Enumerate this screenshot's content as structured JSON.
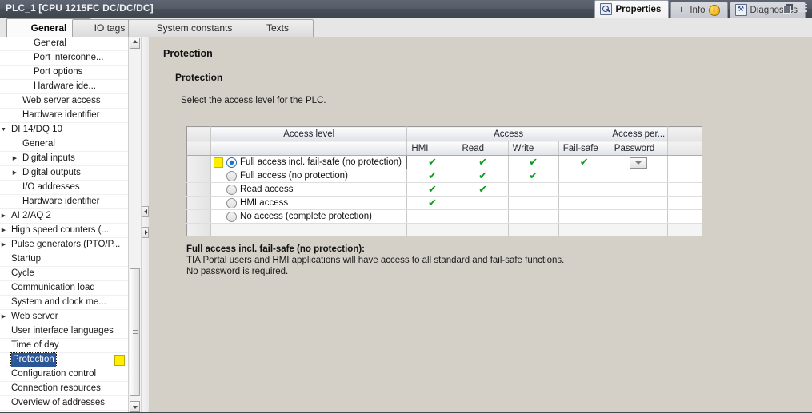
{
  "window": {
    "title": "PLC_1 [CPU 1215FC DC/DC/DC]",
    "tabs": [
      {
        "label": "Properties",
        "icon": "properties-icon",
        "active": true
      },
      {
        "label": "Info",
        "icon": "info-icon",
        "badge": "i",
        "active": false
      },
      {
        "label": "Diagnostics",
        "icon": "diagnostics-icon",
        "active": false
      }
    ],
    "controls": [
      "restore-icon",
      "menu-icon"
    ]
  },
  "main_tabs": [
    {
      "label": "General",
      "active": true
    },
    {
      "label": "IO tags",
      "active": false
    },
    {
      "label": "System constants",
      "active": false
    },
    {
      "label": "Texts",
      "active": false
    }
  ],
  "nav": {
    "items": [
      {
        "label": "General",
        "indent": 3,
        "arrow": "",
        "selected": false,
        "marker": false
      },
      {
        "label": "Port interconne...",
        "indent": 3,
        "arrow": "",
        "selected": false,
        "marker": false
      },
      {
        "label": "Port options",
        "indent": 3,
        "arrow": "",
        "selected": false,
        "marker": false
      },
      {
        "label": "Hardware ide...",
        "indent": 3,
        "arrow": "",
        "selected": false,
        "marker": false
      },
      {
        "label": "Web server access",
        "indent": 2,
        "arrow": "",
        "selected": false,
        "marker": false
      },
      {
        "label": "Hardware identifier",
        "indent": 2,
        "arrow": "",
        "selected": false,
        "marker": false
      },
      {
        "label": "DI 14/DQ 10",
        "indent": 1,
        "arrow": "expanded",
        "selected": false,
        "marker": false
      },
      {
        "label": "General",
        "indent": 2,
        "arrow": "",
        "selected": false,
        "marker": false
      },
      {
        "label": "Digital inputs",
        "indent": 2,
        "arrow": "collapsed",
        "selected": false,
        "marker": false
      },
      {
        "label": "Digital outputs",
        "indent": 2,
        "arrow": "collapsed",
        "selected": false,
        "marker": false
      },
      {
        "label": "I/O addresses",
        "indent": 2,
        "arrow": "",
        "selected": false,
        "marker": false
      },
      {
        "label": "Hardware identifier",
        "indent": 2,
        "arrow": "",
        "selected": false,
        "marker": false
      },
      {
        "label": "AI 2/AQ 2",
        "indent": 1,
        "arrow": "collapsed",
        "selected": false,
        "marker": false
      },
      {
        "label": "High speed counters (...",
        "indent": 1,
        "arrow": "collapsed",
        "selected": false,
        "marker": false
      },
      {
        "label": "Pulse generators (PTO/P...",
        "indent": 1,
        "arrow": "collapsed",
        "selected": false,
        "marker": false
      },
      {
        "label": "Startup",
        "indent": 1,
        "arrow": "",
        "selected": false,
        "marker": false
      },
      {
        "label": "Cycle",
        "indent": 1,
        "arrow": "",
        "selected": false,
        "marker": false
      },
      {
        "label": "Communication load",
        "indent": 1,
        "arrow": "",
        "selected": false,
        "marker": false
      },
      {
        "label": "System and clock me...",
        "indent": 1,
        "arrow": "",
        "selected": false,
        "marker": false
      },
      {
        "label": "Web server",
        "indent": 1,
        "arrow": "collapsed",
        "selected": false,
        "marker": false
      },
      {
        "label": "User interface languages",
        "indent": 1,
        "arrow": "",
        "selected": false,
        "marker": false
      },
      {
        "label": "Time of day",
        "indent": 1,
        "arrow": "",
        "selected": false,
        "marker": false
      },
      {
        "label": "Protection",
        "indent": 1,
        "arrow": "",
        "selected": true,
        "marker": true
      },
      {
        "label": "Configuration control",
        "indent": 1,
        "arrow": "",
        "selected": false,
        "marker": false
      },
      {
        "label": "Connection resources",
        "indent": 1,
        "arrow": "",
        "selected": false,
        "marker": false
      },
      {
        "label": "Overview of addresses",
        "indent": 1,
        "arrow": "",
        "selected": false,
        "marker": false
      }
    ]
  },
  "page": {
    "breadcrumb": "Protection",
    "group_title": "Protection",
    "instruction": "Select the access level for the PLC."
  },
  "table": {
    "header_top": {
      "access_level": "Access level",
      "access": "Access",
      "access_permission": "Access per..."
    },
    "header_sub": {
      "hmi": "HMI",
      "read": "Read",
      "write": "Write",
      "failsafe": "Fail-safe",
      "password": "Password"
    },
    "check_glyph": "✔",
    "rows": [
      {
        "label": "Full access incl. fail-safe (no protection)",
        "selected": true,
        "marker": true,
        "hmi": true,
        "read": true,
        "write": true,
        "failsafe": true,
        "password_button": true
      },
      {
        "label": "Full access (no protection)",
        "selected": false,
        "marker": false,
        "hmi": true,
        "read": true,
        "write": true,
        "failsafe": false,
        "password_button": false
      },
      {
        "label": "Read access",
        "selected": false,
        "marker": false,
        "hmi": true,
        "read": true,
        "write": false,
        "failsafe": false,
        "password_button": false
      },
      {
        "label": "HMI access",
        "selected": false,
        "marker": false,
        "hmi": true,
        "read": false,
        "write": false,
        "failsafe": false,
        "password_button": false
      },
      {
        "label": "No access (complete protection)",
        "selected": false,
        "marker": false,
        "hmi": false,
        "read": false,
        "write": false,
        "failsafe": false,
        "password_button": false
      }
    ]
  },
  "description": {
    "title": "Full access incl. fail-safe (no protection):",
    "line1": "TIA Portal users and HMI applications will have access to all standard and fail-safe functions.",
    "line2": "No password is required."
  },
  "colors": {
    "titlebar": "#4a515c",
    "selection": "#2b5797",
    "marker_yellow": "#ffee00",
    "check_green": "#0a9a1e",
    "panel": "#d4d0c8"
  }
}
